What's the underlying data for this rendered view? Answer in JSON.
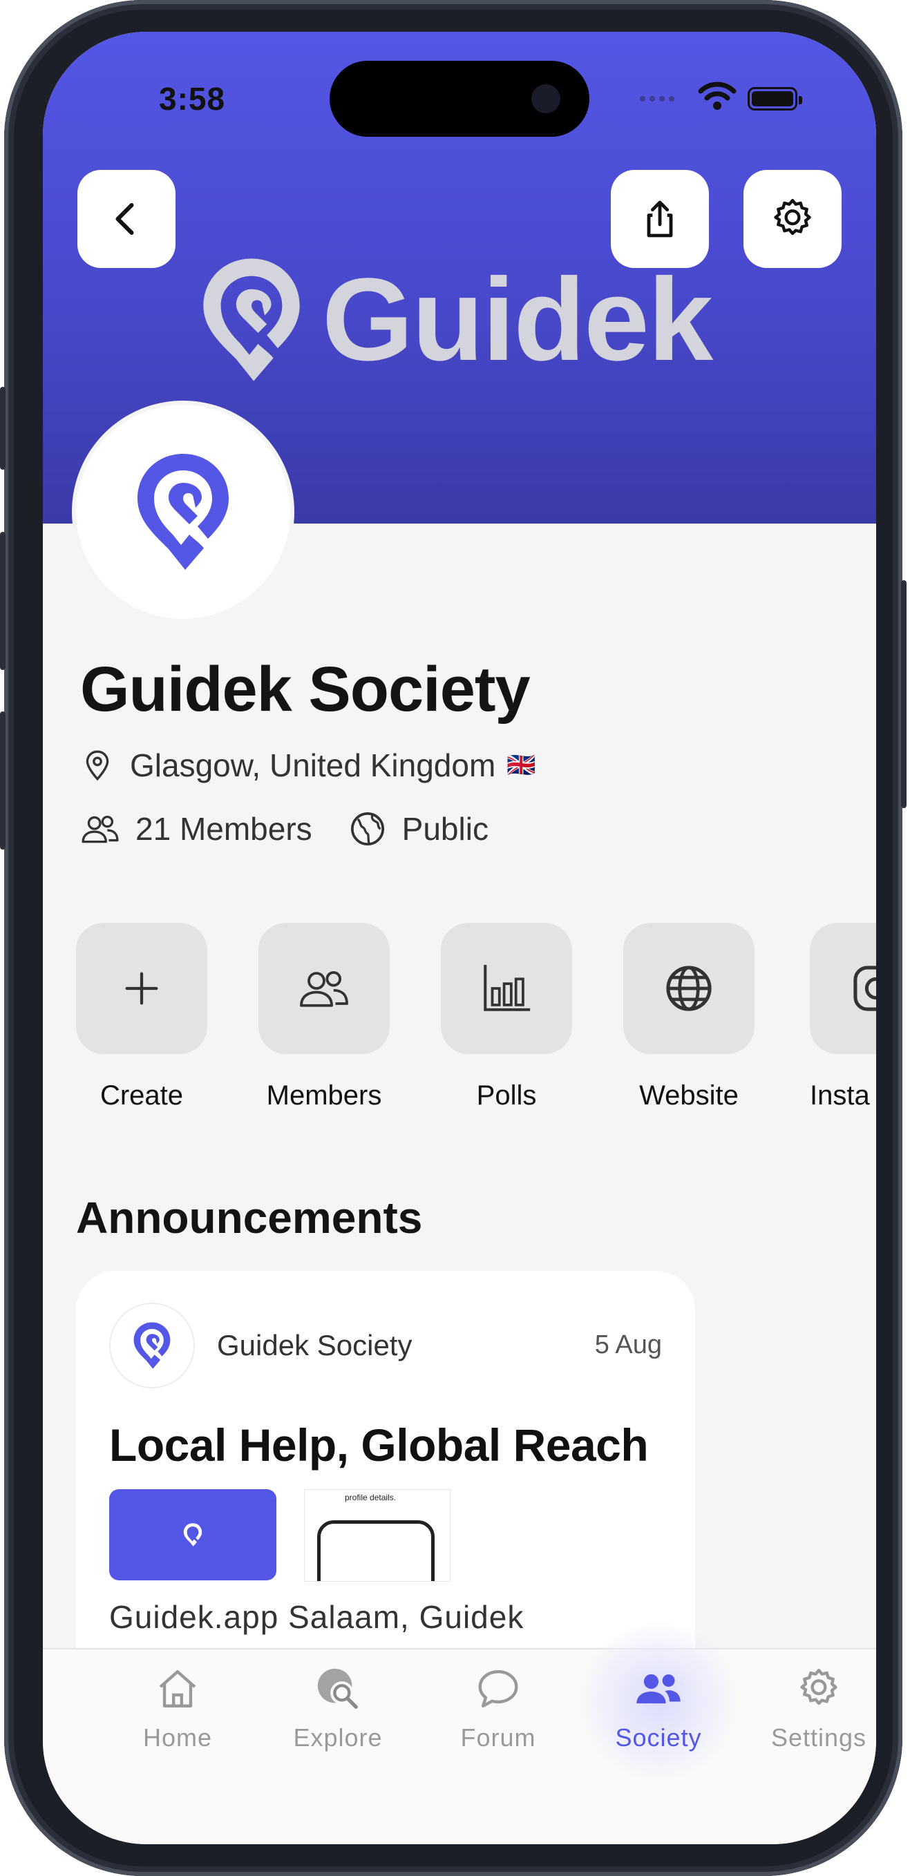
{
  "status_bar": {
    "time": "3:58"
  },
  "header": {
    "brand_word": "Guidek",
    "buttons": {
      "back": "chevron-left-icon",
      "share": "share-icon",
      "settings": "gear-icon"
    },
    "colors": {
      "top": "#5457e6",
      "bottom": "#3a3aa8"
    }
  },
  "society": {
    "name": "Guidek Society",
    "location": "Glasgow, United Kingdom",
    "flag": "🇬🇧",
    "members": "21 Members",
    "visibility": "Public"
  },
  "actions": [
    {
      "label": "Create",
      "icon": "plus-icon"
    },
    {
      "label": "Members",
      "icon": "members-icon"
    },
    {
      "label": "Polls",
      "icon": "bar-chart-icon"
    },
    {
      "label": "Website",
      "icon": "globe-icon"
    },
    {
      "label": "Insta",
      "icon": "instagram-icon"
    }
  ],
  "announcements": {
    "heading": "Announcements",
    "card": {
      "author": "Guidek Society",
      "date": "5 Aug",
      "title": "Local Help, Global Reach",
      "thumb_caption": "profile details.",
      "snippet": "Guidek.app Salaam, Guidek"
    }
  },
  "tabbar": {
    "active": "Society",
    "accent": "#5457e6",
    "items": [
      {
        "label": "Home",
        "icon": "home-icon"
      },
      {
        "label": "Explore",
        "icon": "explore-icon"
      },
      {
        "label": "Forum",
        "icon": "forum-icon"
      },
      {
        "label": "Society",
        "icon": "society-icon"
      },
      {
        "label": "Settings",
        "icon": "settings-icon"
      }
    ]
  }
}
